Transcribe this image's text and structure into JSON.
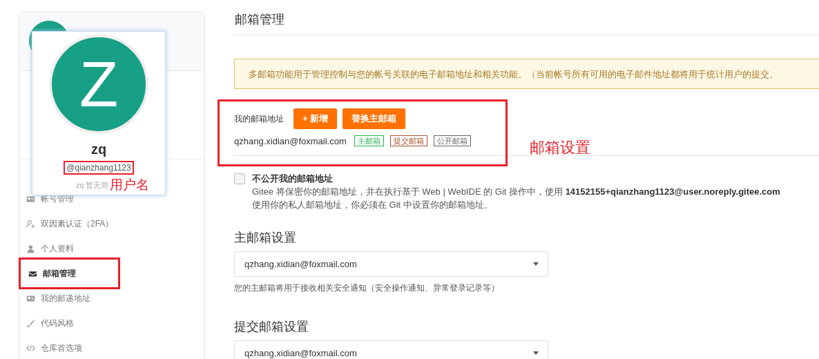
{
  "profile_popup": {
    "avatar_letter": "Z",
    "name": "zq",
    "username": "@qianzhang1123",
    "username_annotated": true,
    "bio": "zq 暂无简",
    "annotation_label": "用户名"
  },
  "sidebar": {
    "items": [
      {
        "label": "帐号管理",
        "selected": false,
        "annotated": false
      },
      {
        "label": "双因素认证（2FA）",
        "selected": false,
        "annotated": false
      },
      {
        "label": "个人资料",
        "selected": false,
        "annotated": false
      },
      {
        "label": "邮箱管理",
        "selected": true,
        "annotated": true
      },
      {
        "label": "我的邮递地址",
        "selected": false,
        "annotated": false
      },
      {
        "label": "代码风格",
        "selected": false,
        "annotated": false
      },
      {
        "label": "仓库首选项",
        "selected": false,
        "annotated": false
      }
    ]
  },
  "page_title": "邮箱管理",
  "alert": "多邮箱功能用于管理控制与您的帐号关联的电子邮箱地址和相关功能。（当前帐号所有可用的电子邮件地址都将用于统计用户的提交。",
  "my_emails": {
    "label": "我的邮箱地址",
    "annotated": true,
    "annotation_label": "邮箱设置",
    "buttons": [
      "+ 新增",
      "替换主邮箱"
    ],
    "emails": [
      {
        "address": "qzhang.xidian@foxmail.com",
        "tags": [
          {
            "label": "主邮箱",
            "color": "#21b351"
          },
          {
            "label": "提交邮箱",
            "color": "#a0522d"
          },
          {
            "label": "公开邮箱",
            "color": "#666666"
          }
        ]
      }
    ]
  },
  "private_option": {
    "label": "不公开我的邮箱地址",
    "checked": false,
    "description": [
      "Gitee 将保密你的邮箱地址，并在执行基于 Web | WebIDE 的 Git 操作中，使用 **14152155+qianzhang1123@user.noreply.gitee.com**",
      "使用你的私人邮箱地址，你必须在 Git 中设置你的邮箱地址。"
    ]
  },
  "primary_email": {
    "heading": "主邮箱设置",
    "value": "qzhang.xidian@foxmail.com",
    "hint": "您的主邮箱将用于接收相关安全通知（安全操作通知、异常登录记录等）"
  },
  "commit_email": {
    "heading": "提交邮箱设置",
    "value": "qzhang.xidian@foxmail.com"
  }
}
